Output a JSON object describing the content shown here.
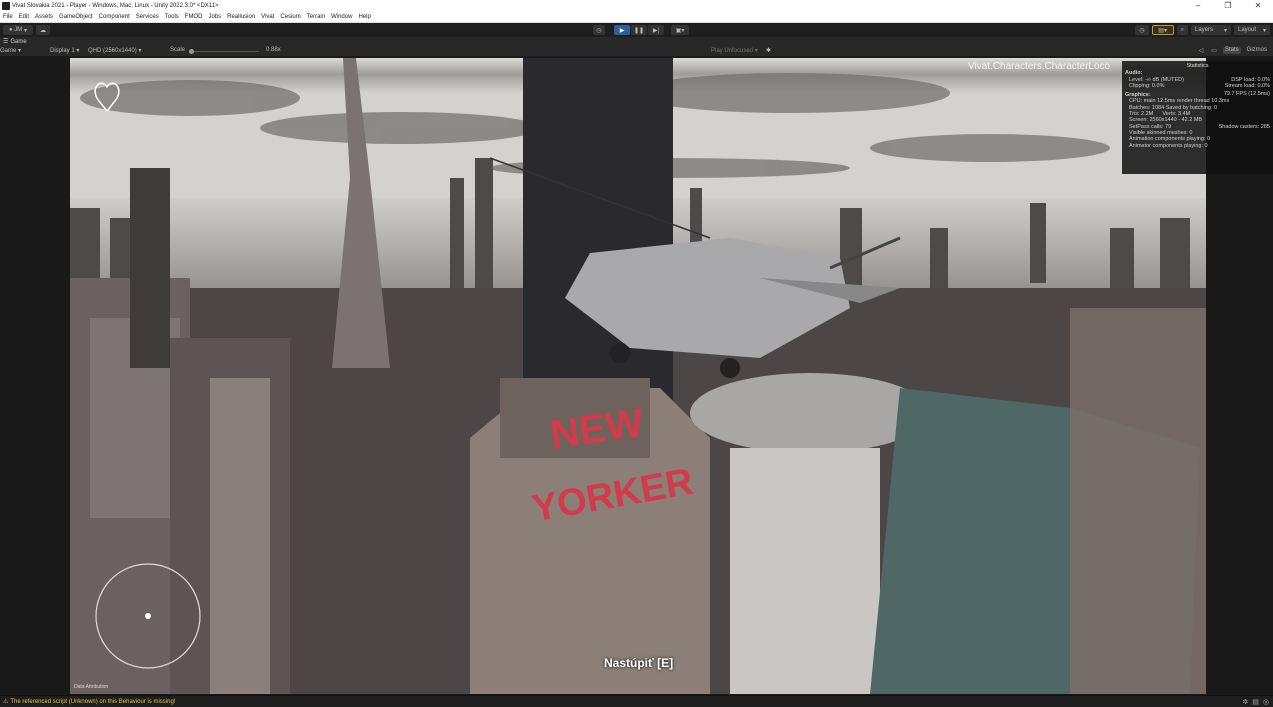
{
  "window": {
    "title": "Vivat Slovakia 2021 - Player - Windows, Mac, Linux - Unity 2022.3.0* <DX11>"
  },
  "menu": [
    "File",
    "Edit",
    "Assets",
    "GameObject",
    "Component",
    "Services",
    "Tools",
    "FMOD",
    "Jobs",
    "Reallusion",
    "Vivat",
    "Cesium",
    "Terrain",
    "Window",
    "Help"
  ],
  "toolbar": {
    "account": "JM",
    "layers": "Layers",
    "layout": "Layout"
  },
  "game_tab": {
    "label": "Game"
  },
  "game_controls": {
    "view": "Game",
    "display": "Display 1",
    "resolution": "QHD (2560x1440)",
    "scale_label": "Scale",
    "scale_value": "0.88x",
    "play_focus": "Play Unfocused",
    "stats": "Stats",
    "gizmos": "Gizmos"
  },
  "overlay": {
    "character_label": "Vivat.Characters.CharacterLoco",
    "interaction_prompt": "Nastúpiť [E]",
    "data_attribution": "Data Attribution",
    "sign_top": "NEW",
    "sign_bottom": "YORKER"
  },
  "stats": {
    "header": "Statistics",
    "audio_title": "Audio:",
    "audio_level": "Level: -∞ dB (MUTED)",
    "audio_clipping": "Clipping: 0.0%",
    "dsp_load": "DSP load: 0.0%",
    "stream_load": "Stream load: 0.0%",
    "graphics_title": "Graphics:",
    "fps": "79.7 FPS (12.5ms)",
    "cpu": "CPU: main 12.5ms  render thread 10.3ms",
    "batches": "Batches: 1084   Saved by batching: 0",
    "tris": "Tris: 2.2M",
    "verts": "Verts: 3.4M",
    "screen": "Screen: 2560x1440 - 42.2 MB",
    "setpass": "SetPass calls: 79",
    "shadow_casters": "Shadow casters: 285",
    "skinned": "Visible skinned meshes: 0",
    "animation": "Animation components playing: 0",
    "animator": "Animator components playing: 0"
  },
  "status": {
    "warning": "The referenced script (Unknown) on this Behaviour is missing!"
  },
  "colors": {
    "accent": "#2e5f99",
    "warning": "#e9c13b",
    "sign": "#d33a4a"
  }
}
